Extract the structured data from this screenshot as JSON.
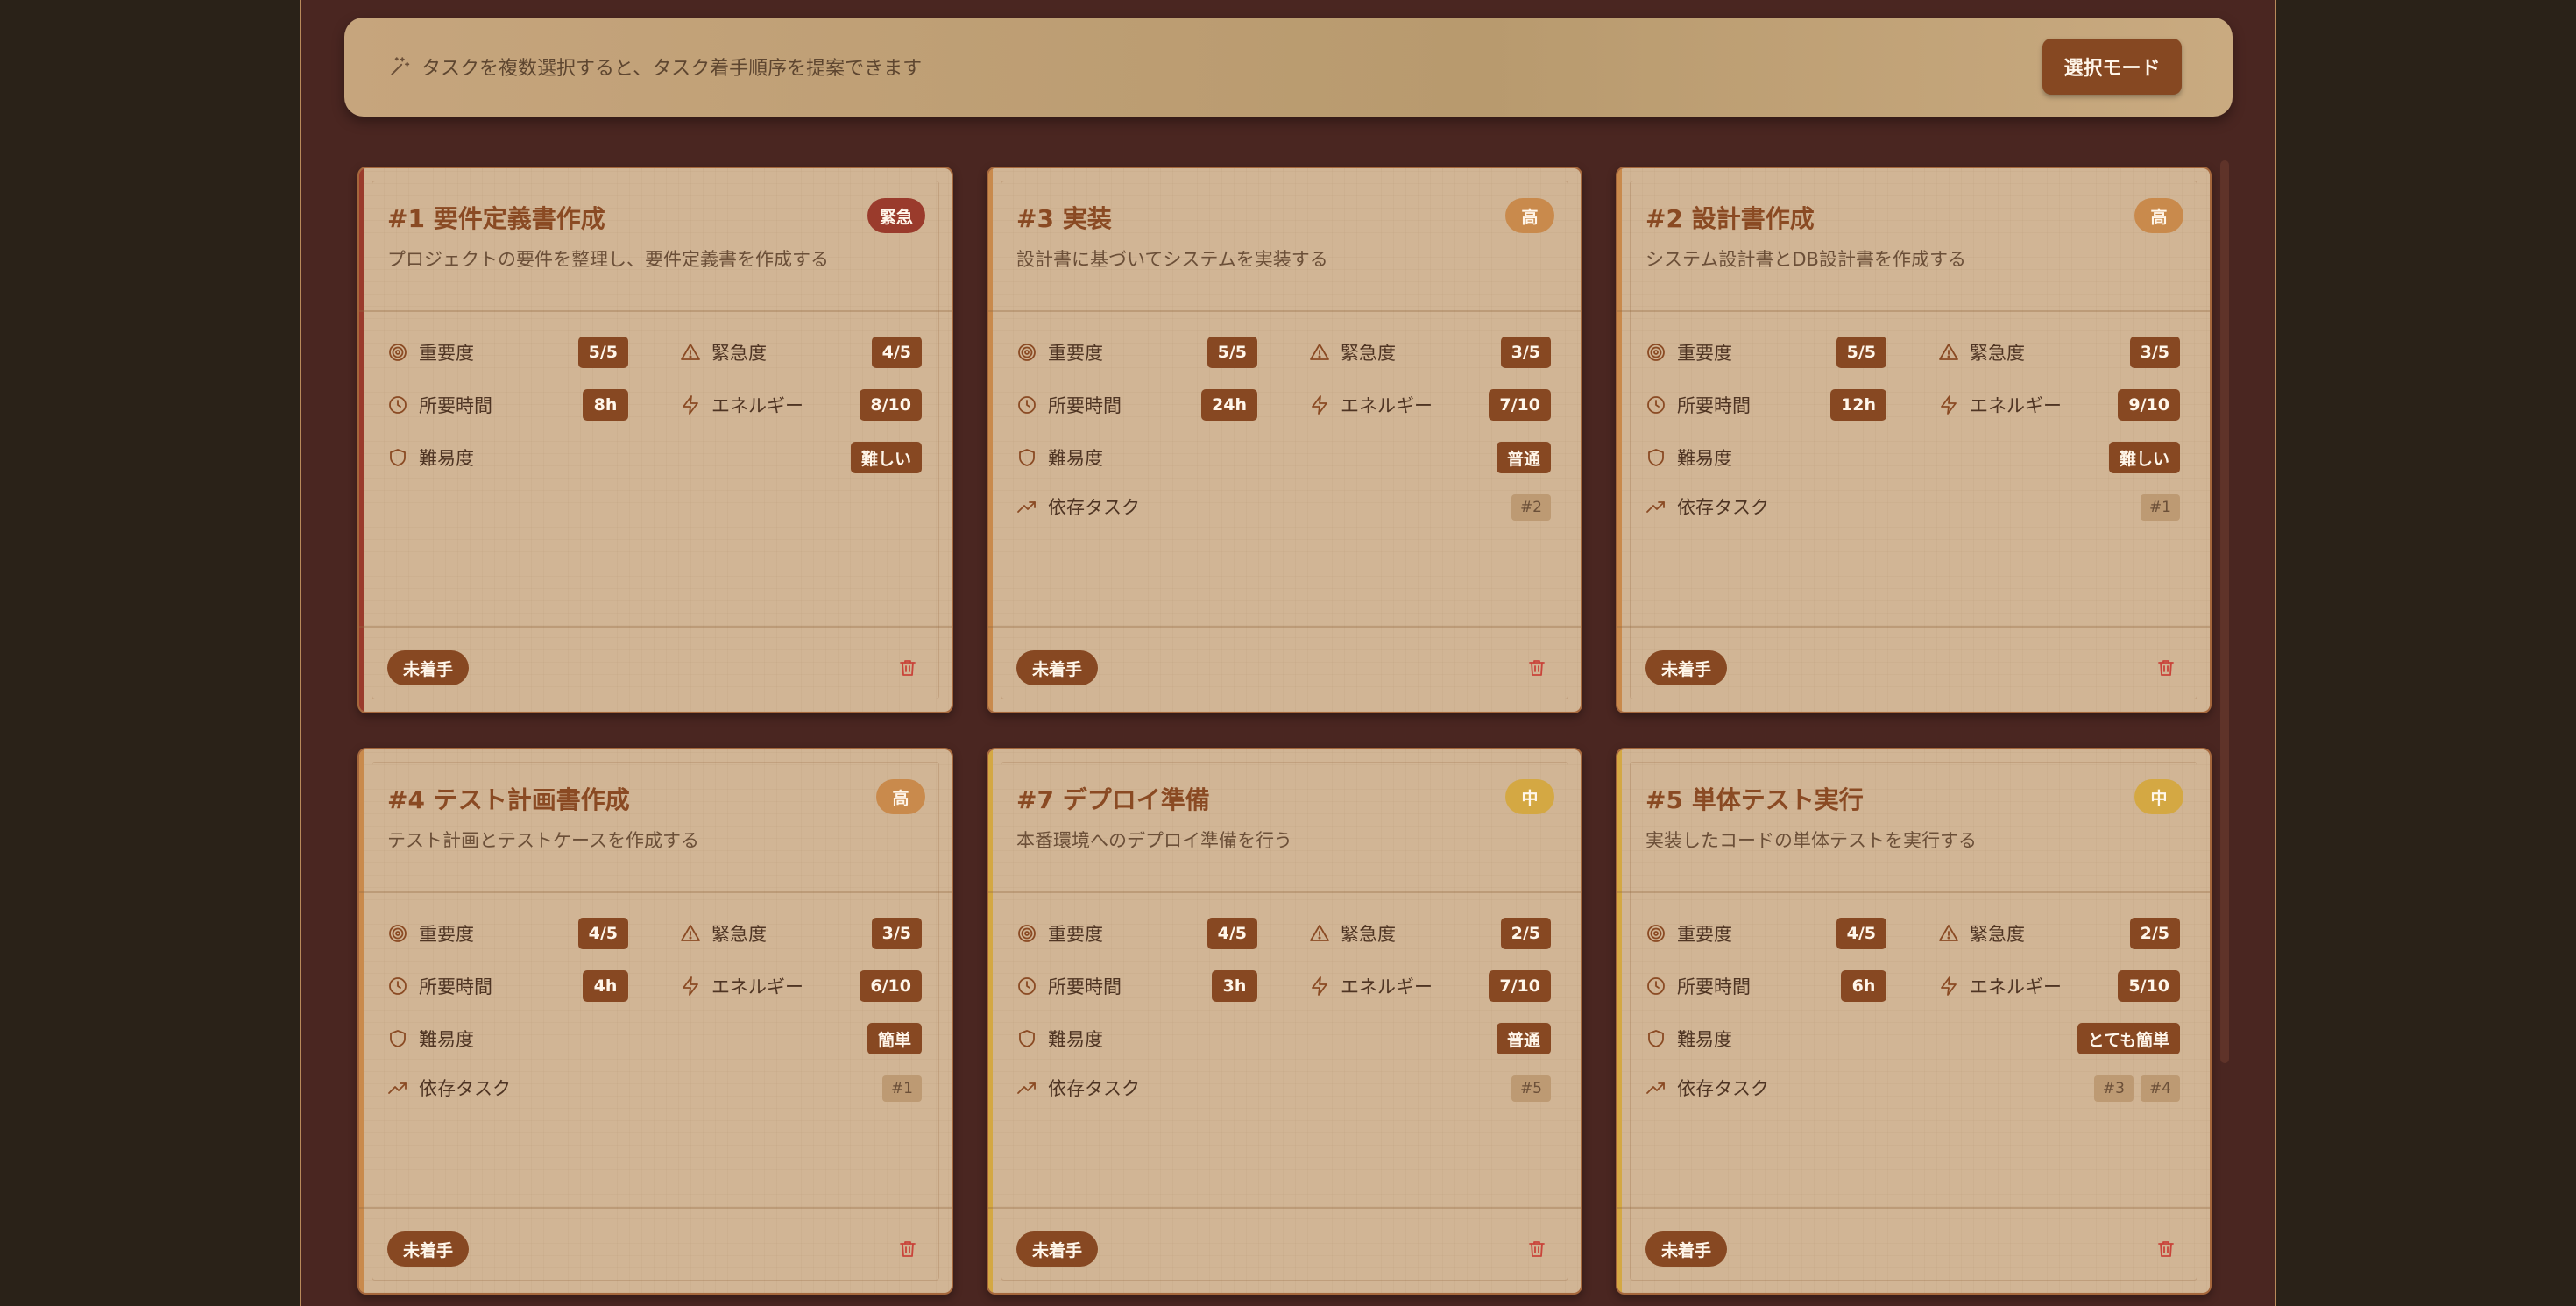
{
  "banner": {
    "text": "タスクを複数選択すると、タスク着手順序を提案できます",
    "button_label": "選択モード"
  },
  "labels": {
    "importance": "重要度",
    "urgency": "緊急度",
    "duration": "所要時間",
    "energy": "エネルギー",
    "difficulty": "難易度",
    "dependencies": "依存タスク"
  },
  "colors": {
    "urgent": "#9a3b2c",
    "high": "#c98a4c",
    "medium": "#d4a843",
    "value_badge": "#874822"
  },
  "cards": [
    {
      "title": "#1 要件定義書作成",
      "priority": "緊急",
      "priority_level": "urgent",
      "description": "プロジェクトの要件を整理し、要件定義書を作成する",
      "importance": "5/5",
      "urgency": "4/5",
      "duration": "8h",
      "energy": "8/10",
      "difficulty": "難しい",
      "dependencies": [],
      "status": "未着手"
    },
    {
      "title": "#3 実装",
      "priority": "高",
      "priority_level": "high",
      "description": "設計書に基づいてシステムを実装する",
      "importance": "5/5",
      "urgency": "3/5",
      "duration": "24h",
      "energy": "7/10",
      "difficulty": "普通",
      "dependencies": [
        "#2"
      ],
      "status": "未着手"
    },
    {
      "title": "#2 設計書作成",
      "priority": "高",
      "priority_level": "high",
      "description": "システム設計書とDB設計書を作成する",
      "importance": "5/5",
      "urgency": "3/5",
      "duration": "12h",
      "energy": "9/10",
      "difficulty": "難しい",
      "dependencies": [
        "#1"
      ],
      "status": "未着手"
    },
    {
      "title": "#4 テスト計画書作成",
      "priority": "高",
      "priority_level": "high",
      "description": "テスト計画とテストケースを作成する",
      "importance": "4/5",
      "urgency": "3/5",
      "duration": "4h",
      "energy": "6/10",
      "difficulty": "簡単",
      "dependencies": [
        "#1"
      ],
      "status": "未着手"
    },
    {
      "title": "#7 デプロイ準備",
      "priority": "中",
      "priority_level": "medium",
      "description": "本番環境へのデプロイ準備を行う",
      "importance": "4/5",
      "urgency": "2/5",
      "duration": "3h",
      "energy": "7/10",
      "difficulty": "普通",
      "dependencies": [
        "#5"
      ],
      "status": "未着手"
    },
    {
      "title": "#5 単体テスト実行",
      "priority": "中",
      "priority_level": "medium",
      "description": "実装したコードの単体テストを実行する",
      "importance": "4/5",
      "urgency": "2/5",
      "duration": "6h",
      "energy": "5/10",
      "difficulty": "とても簡単",
      "dependencies": [
        "#3",
        "#4"
      ],
      "status": "未着手"
    }
  ]
}
